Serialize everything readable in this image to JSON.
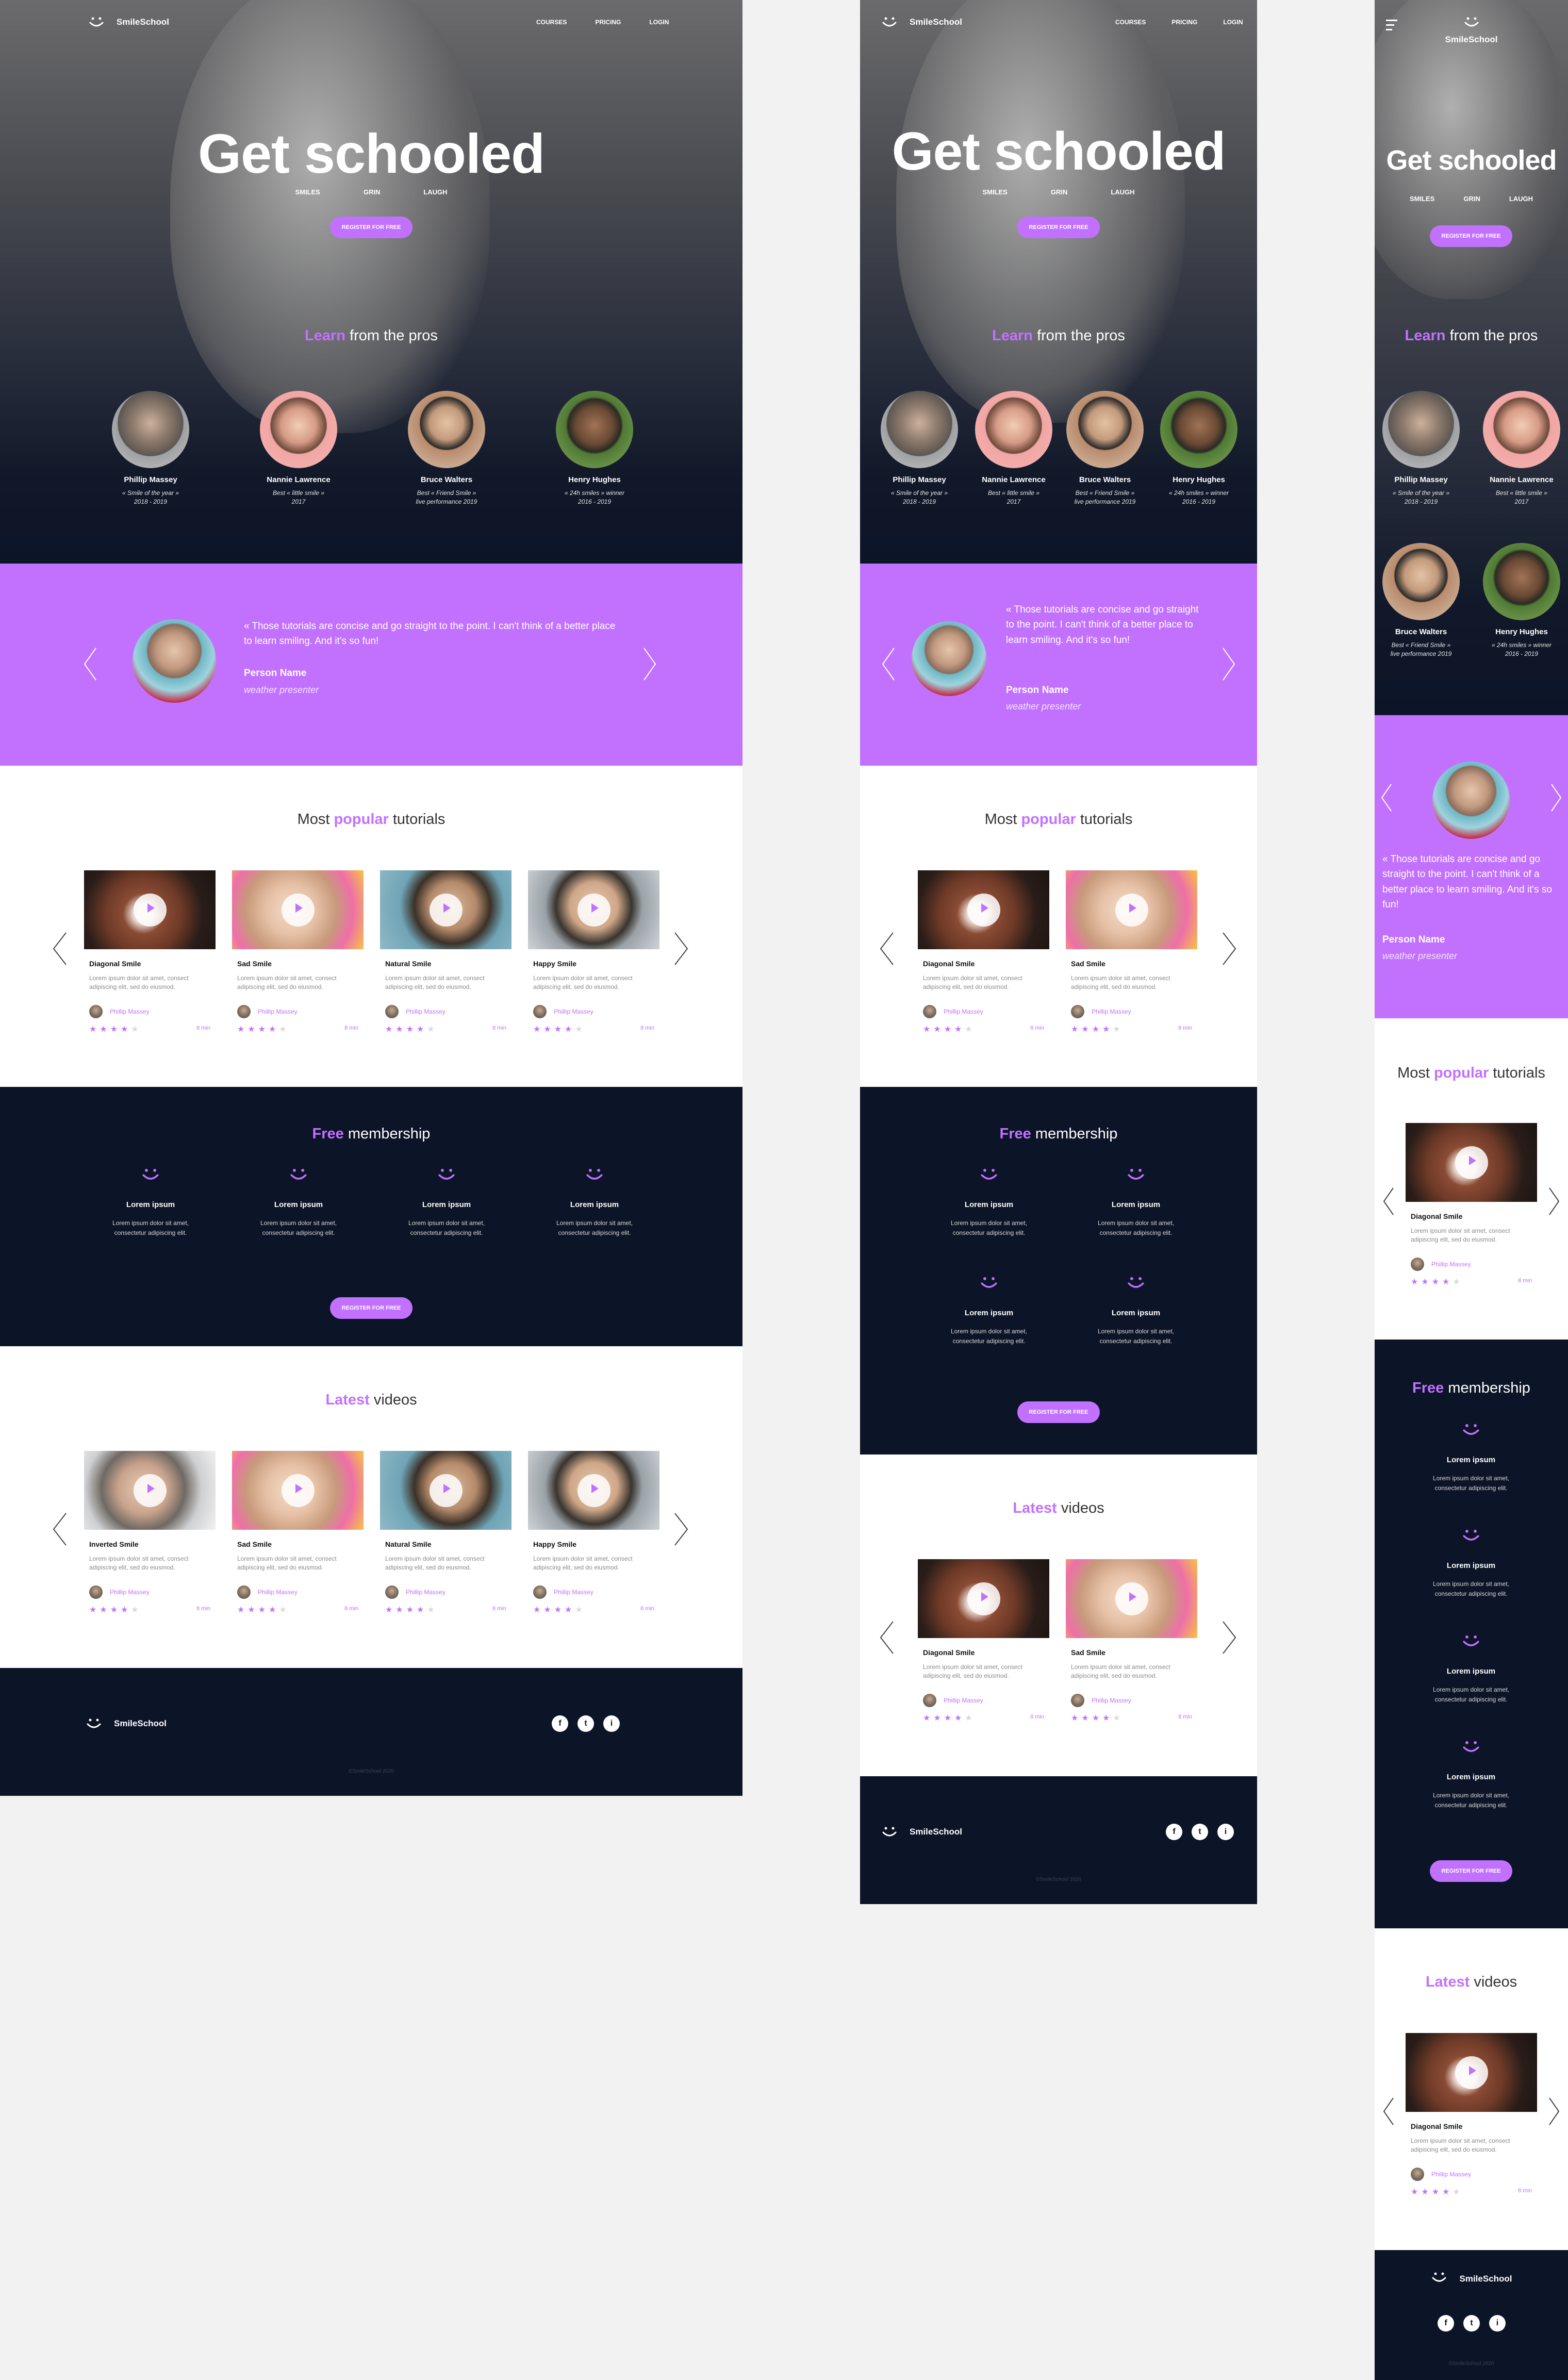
{
  "brand": {
    "name": "SmileSchool"
  },
  "nav": {
    "courses": "COURSES",
    "pricing": "PRICING",
    "login": "LOGIN"
  },
  "hero": {
    "title": "Get schooled",
    "sub": [
      "SMILES",
      "GRIN",
      "LAUGH"
    ],
    "cta": "REGISTER FOR FREE"
  },
  "learn": {
    "accent": "Learn",
    "rest": "from the pros"
  },
  "pros": [
    {
      "name": "Phillip Massey",
      "award1": "« Smile of the year »",
      "award2": "2018 - 2019"
    },
    {
      "name": "Nannie Lawrence",
      "award1": "Best « little smile »",
      "award2": "2017"
    },
    {
      "name": "Bruce Walters",
      "award1": "Best « Friend Smile »",
      "award2": "live performance 2019"
    },
    {
      "name": "Henry Hughes",
      "award1": "« 24h smiles » winner",
      "award2": "2016 - 2019"
    }
  ],
  "quote": {
    "text": "« Those tutorials are concise and go straight to the point. I can't think of a better place to learn smiling. And it's so fun!",
    "name": "Person Name",
    "role": "weather presenter"
  },
  "popular": {
    "pre": "Most",
    "accent": "popular",
    "post": "tutorials"
  },
  "popular_cards": [
    {
      "title": "Diagonal Smile",
      "desc": "Lorem ipsum dolor sit amet, consect adipiscing elit, sed do eiusmod.",
      "author": "Phillip Massey",
      "rating": 4,
      "duration": "8 min"
    },
    {
      "title": "Sad Smile",
      "desc": "Lorem ipsum dolor sit amet, consect adipiscing elit, sed do eiusmod.",
      "author": "Phillip Massey",
      "rating": 4,
      "duration": "8 min"
    },
    {
      "title": "Natural Smile",
      "desc": "Lorem ipsum dolor sit amet, consect adipiscing elit, sed do eiusmod.",
      "author": "Phillip Massey",
      "rating": 4,
      "duration": "8 min"
    },
    {
      "title": "Happy Smile",
      "desc": "Lorem ipsum dolor sit amet, consect adipiscing elit, sed do eiusmod.",
      "author": "Phillip Massey",
      "rating": 4,
      "duration": "8 min"
    }
  ],
  "membership": {
    "accent": "Free",
    "rest": "membership",
    "item_title": "Lorem ipsum",
    "item_desc_1": "Lorem ipsum dolor sit amet,",
    "item_desc_2": "consectetur adipiscing elit.",
    "cta": "REGISTER FOR FREE"
  },
  "latest": {
    "accent": "Latest",
    "rest": "videos"
  },
  "latest_cards": [
    {
      "title": "Inverted Smile",
      "desc": "Lorem ipsum dolor sit amet, consect adipiscing elit, sed do eiusmod.",
      "author": "Phillip Massey",
      "rating": 4,
      "duration": "8 min"
    },
    {
      "title": "Sad Smile",
      "desc": "Lorem ipsum dolor sit amet, consect adipiscing elit, sed do eiusmod.",
      "author": "Phillip Massey",
      "rating": 4,
      "duration": "8 min"
    },
    {
      "title": "Natural Smile",
      "desc": "Lorem ipsum dolor sit amet, consect adipiscing elit, sed do eiusmod.",
      "author": "Phillip Massey",
      "rating": 4,
      "duration": "8 min"
    },
    {
      "title": "Happy Smile",
      "desc": "Lorem ipsum dolor sit amet, consect adipiscing elit, sed do eiusmod.",
      "author": "Phillip Massey",
      "rating": 4,
      "duration": "8 min"
    }
  ],
  "tablet_latest_cards": [
    {
      "title": "Diagonal Smile",
      "desc": "Lorem ipsum dolor sit amet, consect adipiscing elit, sed do eiusmod.",
      "author": "Phillip Massey",
      "rating": 4,
      "duration": "8 min"
    },
    {
      "title": "Sad Smile",
      "desc": "Lorem ipsum dolor sit amet, consect adipiscing elit, sed do eiusmod.",
      "author": "Phillip Massey",
      "rating": 4,
      "duration": "8 min"
    }
  ],
  "footer": {
    "social": [
      "f",
      "t",
      "i"
    ],
    "copyright": "©SmileSchool 2020"
  },
  "colors": {
    "accent": "#c271ff",
    "navy": "#0c1427",
    "canvas": "#f2f2f2"
  },
  "icons": {
    "logo": "smile-logo-icon",
    "prev": "chevron-left-icon",
    "next": "chevron-right-icon",
    "play": "play-icon",
    "star": "star-icon",
    "menu": "hamburger-menu-icon"
  }
}
